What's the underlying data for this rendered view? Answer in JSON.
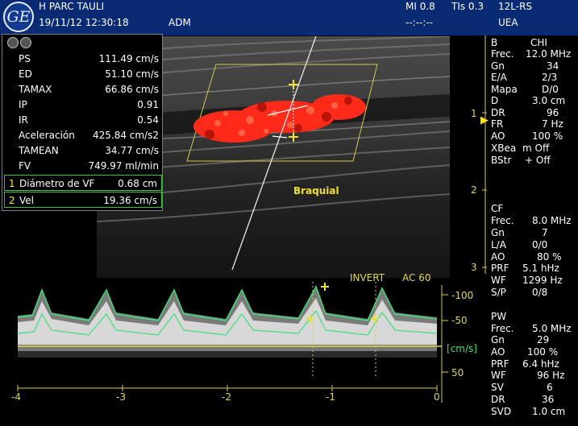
{
  "header": {
    "logo": "GE",
    "site": "H PARC TAULI",
    "datetime": "19/11/12 12:30:18",
    "user": "ADM",
    "mi": "MI 0.8",
    "tis": "TIs 0.3",
    "probe": "12L-RS",
    "time_placeholder": "--:--:--",
    "preset": "UEA"
  },
  "measurements": {
    "rows": [
      {
        "label": "PS",
        "value": "111.49 cm/s"
      },
      {
        "label": "ED",
        "value": "51.10 cm/s"
      },
      {
        "label": "TAMAX",
        "value": "66.86 cm/s"
      },
      {
        "label": "IP",
        "value": "0.91"
      },
      {
        "label": "IR",
        "value": "0.54"
      },
      {
        "label": "Aceleración",
        "value": "425.84 cm/s2"
      },
      {
        "label": "TAMEAN",
        "value": "34.77 cm/s"
      },
      {
        "label": "FV",
        "value": "749.97 ml/min"
      }
    ],
    "box1": {
      "num": "1",
      "label": "Diámetro de VF",
      "value": "0.68 cm"
    },
    "box2": {
      "num": "2",
      "label": "Vel",
      "value": "19.36 cm/s"
    }
  },
  "image": {
    "vessel_label": "Braquial"
  },
  "doppler": {
    "invert_label": "INVERT",
    "ac_label": "AC 60",
    "vel_ticks": [
      "-100",
      "-50",
      "[cm/s]",
      "50"
    ],
    "time_ticks": [
      "-4",
      "-3",
      "-2",
      "-1",
      "0"
    ]
  },
  "depth_scale": [
    "1",
    "2",
    "3"
  ],
  "params": {
    "b_mode": {
      "title": "B",
      "title_value": "CHI",
      "items": [
        {
          "label": "Frec.",
          "value": "12.0 MHz"
        },
        {
          "label": "Gn",
          "value": "34"
        },
        {
          "label": "E/A",
          "value": "2/3"
        },
        {
          "label": "Mapa",
          "value": "D/0"
        },
        {
          "label": "D",
          "value": "3.0 cm"
        },
        {
          "label": "DR",
          "value": "96"
        },
        {
          "label": "FR",
          "value": "7 Hz"
        },
        {
          "label": "AO",
          "value": "100 %"
        },
        {
          "label": "XBea",
          "value": "m Off"
        },
        {
          "label": "BStr",
          "value": "+ Off"
        }
      ]
    },
    "cf": {
      "title": "CF",
      "items": [
        {
          "label": "Frec.",
          "value": "8.0 MHz"
        },
        {
          "label": "Gn",
          "value": "7"
        },
        {
          "label": "L/A",
          "value": "0/0"
        },
        {
          "label": "AO",
          "value": "80 %"
        },
        {
          "label": "PRF",
          "value": "5.1 hHz"
        },
        {
          "label": "WF",
          "value": "1299 Hz"
        },
        {
          "label": "S/P",
          "value": "0/8"
        }
      ]
    },
    "pw": {
      "title": "PW",
      "items": [
        {
          "label": "Frec.",
          "value": "5.0 MHz"
        },
        {
          "label": "Gn",
          "value": "29"
        },
        {
          "label": "AO",
          "value": "100 %"
        },
        {
          "label": "PRF",
          "value": "6.4 hHz"
        },
        {
          "label": "WF",
          "value": "96 Hz"
        },
        {
          "label": "SV",
          "value": "6"
        },
        {
          "label": "DR",
          "value": "36"
        },
        {
          "label": "SVD",
          "value": "1.0 cm"
        }
      ]
    }
  },
  "colors": {
    "header_bg": "#0a2a73",
    "color_flow": "#ff2a1a",
    "waveform": "#3fe07a",
    "cursor": "#f0e12a"
  }
}
